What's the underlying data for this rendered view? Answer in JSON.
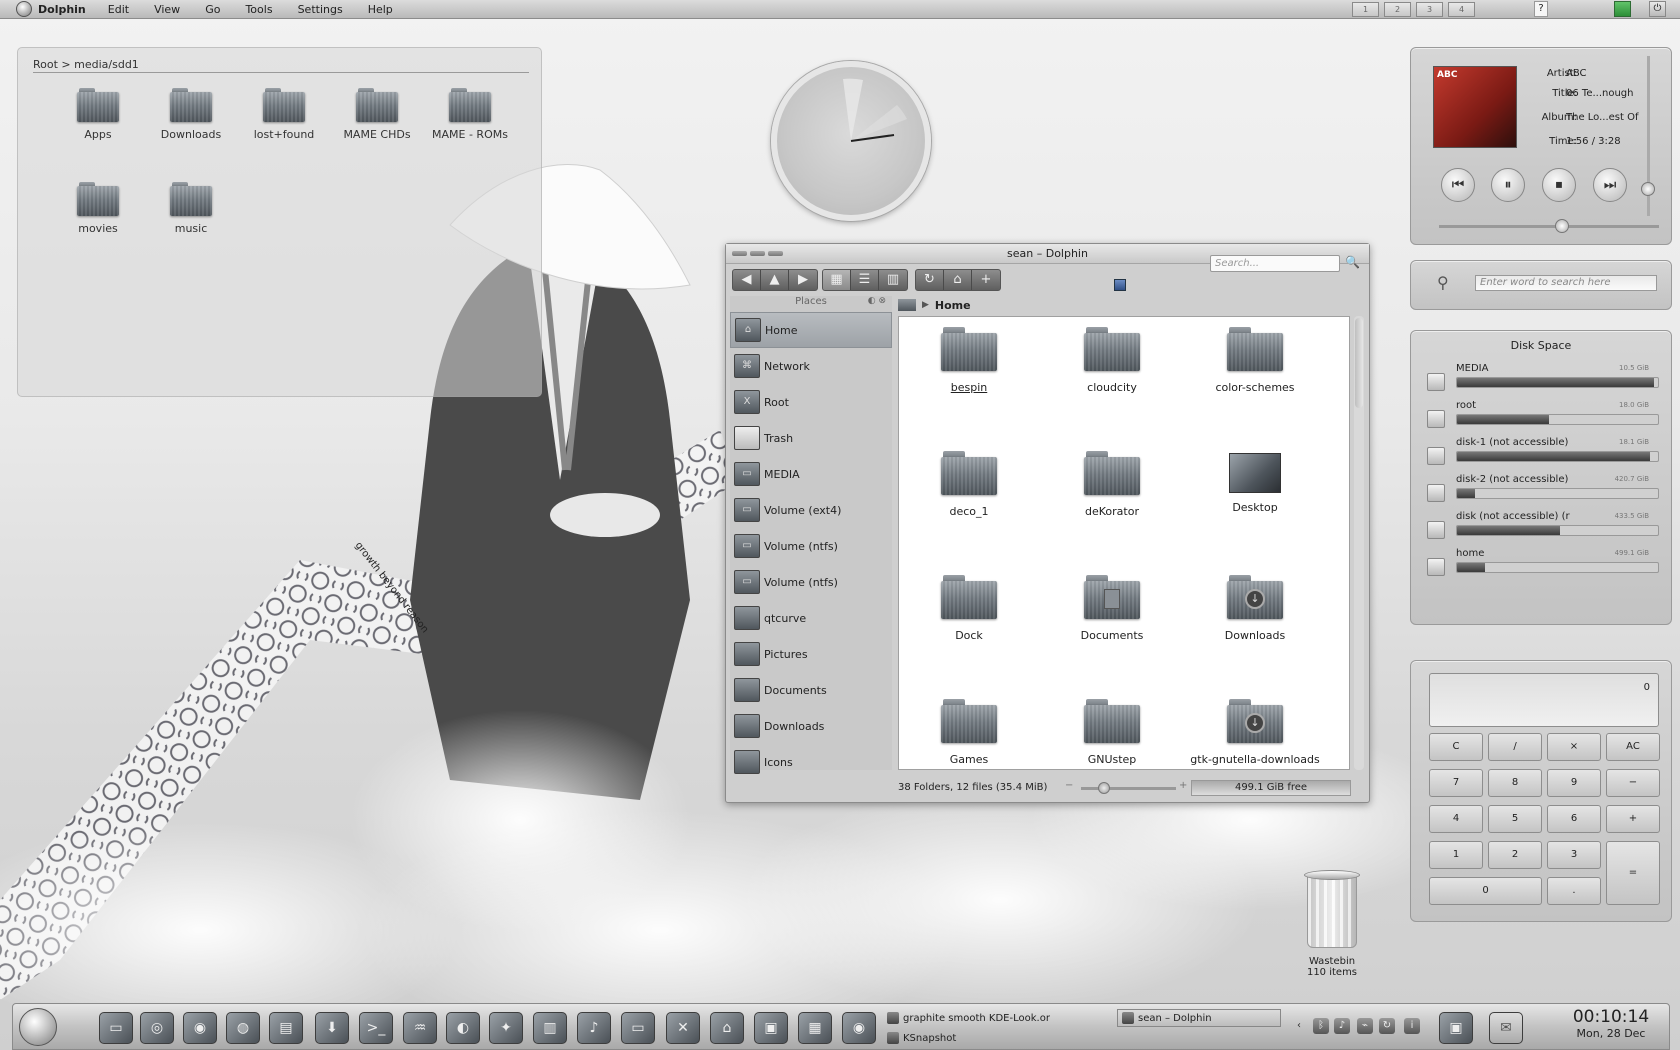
{
  "menubar": {
    "app_name": "Dolphin",
    "items": [
      "Edit",
      "View",
      "Go",
      "Tools",
      "Settings",
      "Help"
    ],
    "pager": [
      "1",
      "2",
      "3",
      "4"
    ]
  },
  "folderview": {
    "path": "Root > media/sdd1",
    "items": [
      "Apps",
      "Downloads",
      "lost+found",
      "MAME CHDs",
      "MAME - ROMs",
      "movies",
      "music"
    ]
  },
  "wallpaper": {
    "caption": "growth beyond reason"
  },
  "dolphin": {
    "title": "sean – Dolphin",
    "search_placeholder": "Search...",
    "places_title": "Places",
    "places": [
      {
        "label": "Home",
        "icon": "home-icon",
        "selected": true
      },
      {
        "label": "Network",
        "icon": "network-icon"
      },
      {
        "label": "Root",
        "icon": "root-icon"
      },
      {
        "label": "Trash",
        "icon": "trash-icon"
      },
      {
        "label": "MEDIA",
        "icon": "drive-icon"
      },
      {
        "label": "Volume (ext4)",
        "icon": "drive-icon"
      },
      {
        "label": "Volume (ntfs)",
        "icon": "drive-icon"
      },
      {
        "label": "Volume (ntfs)",
        "icon": "drive-icon"
      },
      {
        "label": "qtcurve",
        "icon": "folder-icon"
      },
      {
        "label": "Pictures",
        "icon": "folder-icon"
      },
      {
        "label": "Documents",
        "icon": "folder-icon"
      },
      {
        "label": "Downloads",
        "icon": "folder-icon"
      },
      {
        "label": "Icons",
        "icon": "folder-icon"
      }
    ],
    "breadcrumb": "Home",
    "files": [
      "bespin",
      "cloudcity",
      "color-schemes",
      "deco_1",
      "deKorator",
      "Desktop",
      "Dock",
      "Documents",
      "Downloads",
      "Games",
      "GNUstep",
      "gtk-gnutella-downloads"
    ],
    "status": "38 Folders, 12 files (35.4 MiB)",
    "free_space": "499.1 GiB free",
    "free_space_fraction": 0.4
  },
  "now_playing": {
    "cover_text": "ABC",
    "artist_label": "Artist:",
    "artist": "ABC",
    "title_label": "Title:",
    "title": "06 Te...nough",
    "album_label": "Album:",
    "album": "The Lo...est Of",
    "time_label": "Time:",
    "time": "1:56 / 3:28",
    "progress_fraction": 0.557
  },
  "dictionary": {
    "placeholder": "Enter word to search here"
  },
  "disk_space": {
    "title": "Disk Space",
    "disks": [
      {
        "name": "MEDIA",
        "size": "10.5 GiB",
        "used": 0.98
      },
      {
        "name": "root",
        "size": "18.0 GiB",
        "used": 0.46
      },
      {
        "name": "disk-1 (not accessible)",
        "size": "18.1 GiB",
        "used": 0.96
      },
      {
        "name": "disk-2 (not accessible)",
        "size": "420.7 GiB",
        "used": 0.09
      },
      {
        "name": "disk (not accessible) (r",
        "size": "433.5 GiB",
        "used": 0.51
      },
      {
        "name": "home",
        "size": "499.1 GiB",
        "used": 0.14
      }
    ]
  },
  "calculator": {
    "display": "0",
    "keys": [
      "C",
      "/",
      "×",
      "AC",
      "7",
      "8",
      "9",
      "−",
      "4",
      "5",
      "6",
      "+",
      "1",
      "2",
      "3",
      "=",
      "0",
      "."
    ]
  },
  "wastebin": {
    "label": "Wastebin",
    "count": "110 items"
  },
  "taskbar": {
    "tasks": [
      "graphite smooth KDE-Look.or",
      "KSnapshot",
      "sean – Dolphin"
    ],
    "time": "00:10:14",
    "date": "Mon, 28 Dec"
  }
}
